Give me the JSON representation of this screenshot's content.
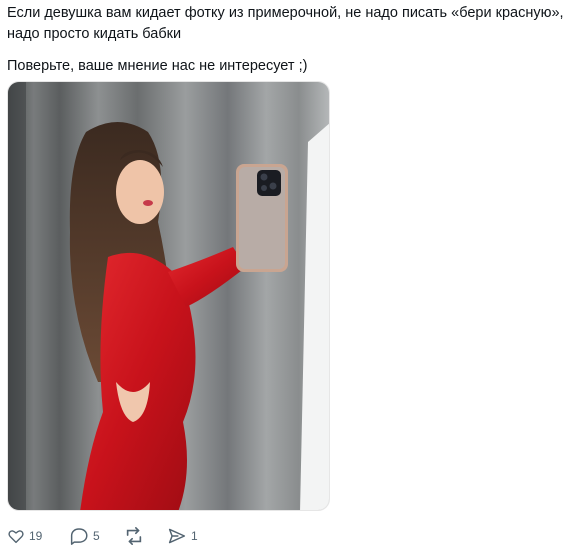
{
  "post": {
    "text_line1": "Если девушка вам кидает фотку из примерочной, не надо писать «бери красную», надо просто кидать бабки",
    "text_line2": "Поверьте, ваше мнение нас не интересует ;)"
  },
  "media": {
    "alt": "photo-mirror-selfie-red-dress"
  },
  "actions": {
    "like": {
      "icon": "heart-icon",
      "count": "19"
    },
    "reply": {
      "icon": "comment-icon",
      "count": "5"
    },
    "repost": {
      "icon": "repost-icon",
      "count": ""
    },
    "share": {
      "icon": "send-icon",
      "count": "1"
    }
  },
  "colors": {
    "text": "#0f1419",
    "muted": "#536471",
    "dress": "#d3161f"
  }
}
